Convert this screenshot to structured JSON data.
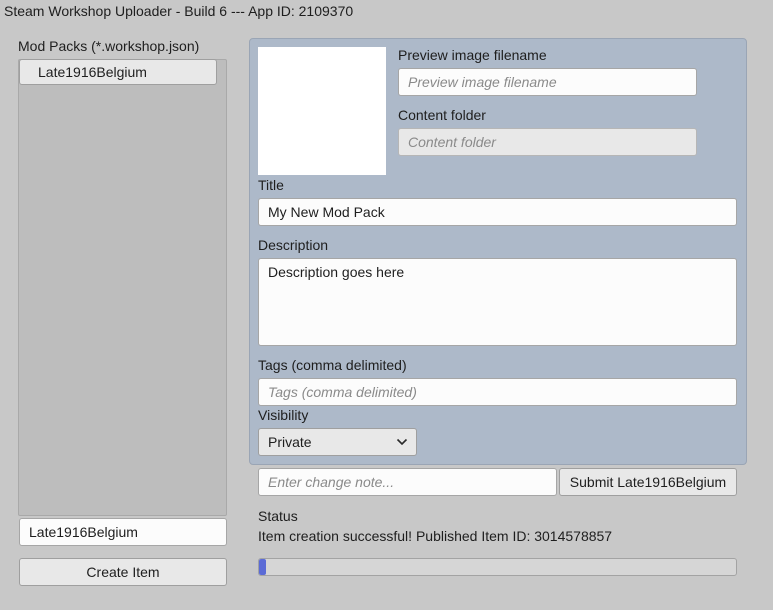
{
  "window": {
    "title": "Steam Workshop Uploader - Build 6 --- App ID: 2109370"
  },
  "left_panel": {
    "header": "Mod Packs (*.workshop.json)",
    "items": [
      "Late1916Belgium"
    ],
    "name_input_value": "Late1916Belgium",
    "create_button_label": "Create Item"
  },
  "details": {
    "preview_label": "Preview image filename",
    "preview_placeholder": "Preview image filename",
    "content_label": "Content folder",
    "content_placeholder": "Content folder",
    "title_label": "Title",
    "title_value": "My New Mod Pack",
    "description_label": "Description",
    "description_value": "Description goes here",
    "tags_label": "Tags (comma delimited)",
    "tags_placeholder": "Tags (comma delimited)",
    "visibility_label": "Visibility",
    "visibility_value": "Private"
  },
  "submit": {
    "change_note_placeholder": "Enter change note...",
    "button_label": "Submit Late1916Belgium"
  },
  "status": {
    "label": "Status",
    "message": "Item creation successful! Published Item ID: 3014578857",
    "progress": 0.01
  },
  "colors": {
    "window_bg": "#c8c8c8",
    "panel_bg": "#adb9c9",
    "progress_fill": "#5b6bd6"
  },
  "icons": {
    "dropdown": "chevron-down-icon"
  }
}
